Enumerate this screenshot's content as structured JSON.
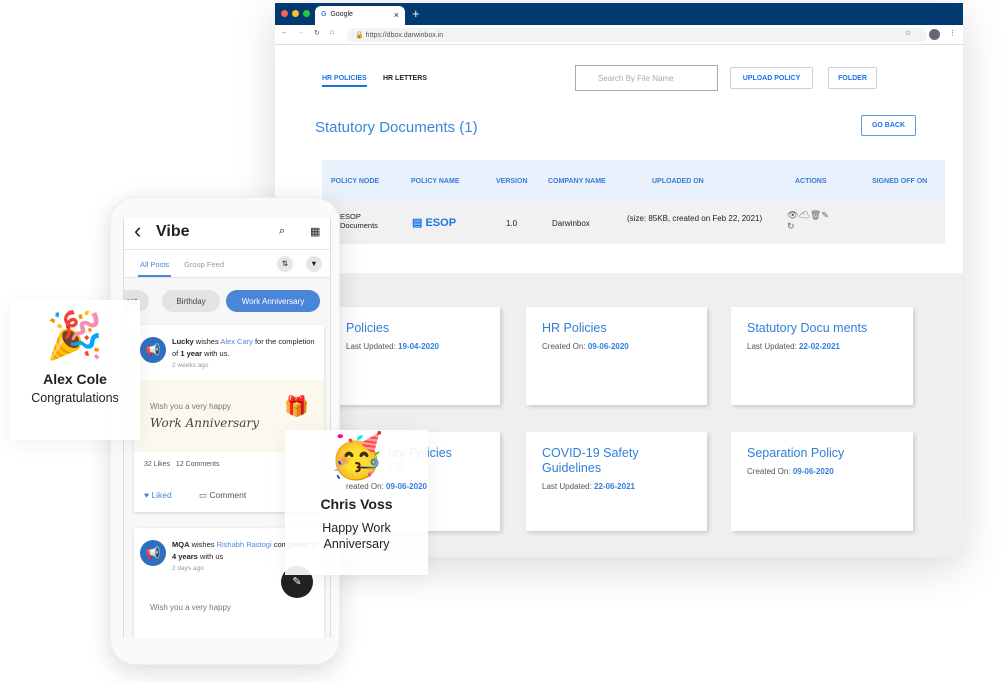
{
  "browser": {
    "tab_title": "Google",
    "url": "https://dbox.darwinbox.in",
    "new_tab": "+",
    "close": "×"
  },
  "nav": {
    "tabs": [
      {
        "label": "HR POLICIES",
        "active": true
      },
      {
        "label": "HR LETTERS"
      }
    ],
    "search_placeholder": "Search By File Name",
    "upload": "UPLOAD POLICY",
    "folder": "FOLDER",
    "go_back": "GO BACK"
  },
  "page_title": "Statutory Documents  (1)",
  "table": {
    "headers": [
      "POLICY NODE",
      "POLICY NAME",
      "VERSION",
      "COMPANY NAME",
      "UPLOADED ON",
      "ACTIONS",
      "SIGNED OFF ON"
    ],
    "row": {
      "node": "ESOP Documents",
      "name": "ESOP",
      "version": "1.0",
      "company": "Darwinbox",
      "uploaded": "(size: 85KB, created on Feb 22, 2021)",
      "signed": ""
    }
  },
  "cards": [
    {
      "title": "Policies",
      "meta_label": "Last Updated:",
      "meta_value": "19-04-2020"
    },
    {
      "title": "HR Policies",
      "meta_label": "Created On:",
      "meta_value": "09-06-2020"
    },
    {
      "title": "Statutory Docu ments",
      "meta_label": "Last Updated:",
      "meta_value": "22-02-2021"
    },
    {
      "title": "ory Policies",
      "subtitle": "Off",
      "meta_label": "reated On:",
      "meta_value": "09-06-2020"
    },
    {
      "title": "COVID-19 Safety Guidelines",
      "meta_label": "Last Updated:",
      "meta_value": "22-06-2021"
    },
    {
      "title": "Separation Policy",
      "meta_label": "Created On:",
      "meta_value": "09-06-2020"
    }
  ],
  "phone": {
    "title": "Vibe",
    "back": "‹",
    "tabs": [
      "All Posts",
      "Group Feed"
    ],
    "filters": [
      "ent",
      "Birthday",
      "Work Anniversary"
    ],
    "posts": [
      {
        "author": "Lucky",
        "verb": " wishes ",
        "target": "Alex Cary",
        "text1": " for the completion of ",
        "bold": "1 year",
        "text2": " with us.",
        "time": "2 weeks ago",
        "banner1": "Wish you a very happy",
        "banner2": "Work Anniversary",
        "likes": "32 Likes",
        "comments": "12 Comments",
        "liked": "Liked",
        "comment_btn": "Comment"
      },
      {
        "author": "MQA",
        "verb": " wishes ",
        "target": "Rishabh Rastogi",
        "text1": " completion of ",
        "bold": "4 years",
        "text2": " with us",
        "time": "2 days ago",
        "banner1": "Wish you a very happy"
      }
    ]
  },
  "popups": [
    {
      "name": "Alex Cole",
      "message": "Congratulations",
      "emoji": "🎉"
    },
    {
      "name": "Chris Voss",
      "message": "Happy Work Anniversary",
      "emoji": "🥳"
    }
  ],
  "colors": {
    "tabbar": "#003a70",
    "accent": "#2f7fd8",
    "page_bg": "#efefef",
    "pill_active": "#4a86d8"
  }
}
